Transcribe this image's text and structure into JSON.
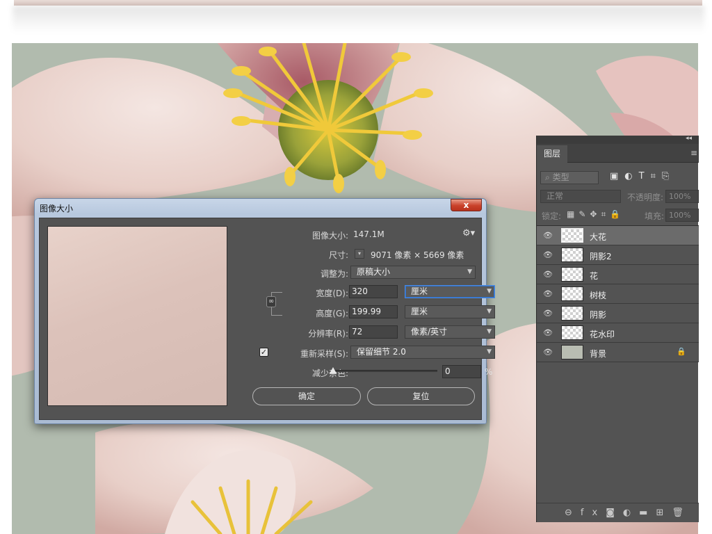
{
  "dialog": {
    "title": "图像大小",
    "close_label": "x",
    "image_size_label": "图像大小:",
    "image_size_value": "147.1M",
    "dimensions_label": "尺寸:",
    "dimensions_value": "9071 像素 × 5669 像素",
    "fit_to_label": "调整为:",
    "fit_to_value": "原稿大小",
    "width_label": "宽度(D):",
    "width_value": "320",
    "width_unit": "厘米",
    "height_label": "高度(G):",
    "height_value": "199.99",
    "height_unit": "厘米",
    "resolution_label": "分辨率(R):",
    "resolution_value": "72",
    "resolution_unit": "像素/英寸",
    "resample_label": "重新采样(S):",
    "resample_checked": true,
    "resample_value": "保留细节 2.0",
    "noise_label": "减少杂色:",
    "noise_value": "0",
    "noise_unit": "%",
    "ok_label": "确定",
    "reset_label": "复位"
  },
  "layers_panel": {
    "tab_label": "图层",
    "filter_placeholder": "类型",
    "blend_mode": "正常",
    "opacity_label": "不透明度:",
    "opacity_value": "100%",
    "lock_label": "锁定:",
    "fill_label": "填充:",
    "fill_value": "100%",
    "layers": [
      {
        "name": "大花",
        "selected": true,
        "locked": false
      },
      {
        "name": "阴影2",
        "selected": false,
        "locked": false
      },
      {
        "name": "花",
        "selected": false,
        "locked": false
      },
      {
        "name": "树枝",
        "selected": false,
        "locked": false
      },
      {
        "name": "阴影",
        "selected": false,
        "locked": false
      },
      {
        "name": "花水印",
        "selected": false,
        "locked": false
      },
      {
        "name": "背景",
        "selected": false,
        "locked": true
      }
    ]
  },
  "colors": {
    "panel_bg": "#535353",
    "selected_layer": "#6b6b6b",
    "focus_blue": "#4c8ae0",
    "petal_pink": "#e9cdc6",
    "stamen_yellow": "#e8c23a"
  }
}
